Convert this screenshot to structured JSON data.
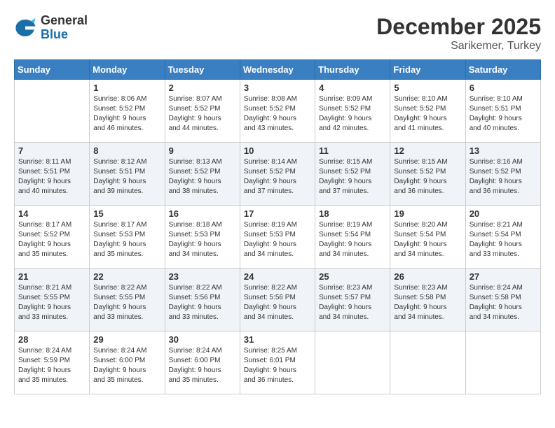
{
  "logo": {
    "general": "General",
    "blue": "Blue"
  },
  "title": {
    "month": "December 2025",
    "location": "Sarikemer, Turkey"
  },
  "weekdays": [
    "Sunday",
    "Monday",
    "Tuesday",
    "Wednesday",
    "Thursday",
    "Friday",
    "Saturday"
  ],
  "weeks": [
    [
      {
        "day": "",
        "info": ""
      },
      {
        "day": "1",
        "info": "Sunrise: 8:06 AM\nSunset: 5:52 PM\nDaylight: 9 hours\nand 46 minutes."
      },
      {
        "day": "2",
        "info": "Sunrise: 8:07 AM\nSunset: 5:52 PM\nDaylight: 9 hours\nand 44 minutes."
      },
      {
        "day": "3",
        "info": "Sunrise: 8:08 AM\nSunset: 5:52 PM\nDaylight: 9 hours\nand 43 minutes."
      },
      {
        "day": "4",
        "info": "Sunrise: 8:09 AM\nSunset: 5:52 PM\nDaylight: 9 hours\nand 42 minutes."
      },
      {
        "day": "5",
        "info": "Sunrise: 8:10 AM\nSunset: 5:52 PM\nDaylight: 9 hours\nand 41 minutes."
      },
      {
        "day": "6",
        "info": "Sunrise: 8:10 AM\nSunset: 5:51 PM\nDaylight: 9 hours\nand 40 minutes."
      }
    ],
    [
      {
        "day": "7",
        "info": "Sunrise: 8:11 AM\nSunset: 5:51 PM\nDaylight: 9 hours\nand 40 minutes."
      },
      {
        "day": "8",
        "info": "Sunrise: 8:12 AM\nSunset: 5:51 PM\nDaylight: 9 hours\nand 39 minutes."
      },
      {
        "day": "9",
        "info": "Sunrise: 8:13 AM\nSunset: 5:52 PM\nDaylight: 9 hours\nand 38 minutes."
      },
      {
        "day": "10",
        "info": "Sunrise: 8:14 AM\nSunset: 5:52 PM\nDaylight: 9 hours\nand 37 minutes."
      },
      {
        "day": "11",
        "info": "Sunrise: 8:15 AM\nSunset: 5:52 PM\nDaylight: 9 hours\nand 37 minutes."
      },
      {
        "day": "12",
        "info": "Sunrise: 8:15 AM\nSunset: 5:52 PM\nDaylight: 9 hours\nand 36 minutes."
      },
      {
        "day": "13",
        "info": "Sunrise: 8:16 AM\nSunset: 5:52 PM\nDaylight: 9 hours\nand 36 minutes."
      }
    ],
    [
      {
        "day": "14",
        "info": "Sunrise: 8:17 AM\nSunset: 5:52 PM\nDaylight: 9 hours\nand 35 minutes."
      },
      {
        "day": "15",
        "info": "Sunrise: 8:17 AM\nSunset: 5:53 PM\nDaylight: 9 hours\nand 35 minutes."
      },
      {
        "day": "16",
        "info": "Sunrise: 8:18 AM\nSunset: 5:53 PM\nDaylight: 9 hours\nand 34 minutes."
      },
      {
        "day": "17",
        "info": "Sunrise: 8:19 AM\nSunset: 5:53 PM\nDaylight: 9 hours\nand 34 minutes."
      },
      {
        "day": "18",
        "info": "Sunrise: 8:19 AM\nSunset: 5:54 PM\nDaylight: 9 hours\nand 34 minutes."
      },
      {
        "day": "19",
        "info": "Sunrise: 8:20 AM\nSunset: 5:54 PM\nDaylight: 9 hours\nand 34 minutes."
      },
      {
        "day": "20",
        "info": "Sunrise: 8:21 AM\nSunset: 5:54 PM\nDaylight: 9 hours\nand 33 minutes."
      }
    ],
    [
      {
        "day": "21",
        "info": "Sunrise: 8:21 AM\nSunset: 5:55 PM\nDaylight: 9 hours\nand 33 minutes."
      },
      {
        "day": "22",
        "info": "Sunrise: 8:22 AM\nSunset: 5:55 PM\nDaylight: 9 hours\nand 33 minutes."
      },
      {
        "day": "23",
        "info": "Sunrise: 8:22 AM\nSunset: 5:56 PM\nDaylight: 9 hours\nand 33 minutes."
      },
      {
        "day": "24",
        "info": "Sunrise: 8:22 AM\nSunset: 5:56 PM\nDaylight: 9 hours\nand 34 minutes."
      },
      {
        "day": "25",
        "info": "Sunrise: 8:23 AM\nSunset: 5:57 PM\nDaylight: 9 hours\nand 34 minutes."
      },
      {
        "day": "26",
        "info": "Sunrise: 8:23 AM\nSunset: 5:58 PM\nDaylight: 9 hours\nand 34 minutes."
      },
      {
        "day": "27",
        "info": "Sunrise: 8:24 AM\nSunset: 5:58 PM\nDaylight: 9 hours\nand 34 minutes."
      }
    ],
    [
      {
        "day": "28",
        "info": "Sunrise: 8:24 AM\nSunset: 5:59 PM\nDaylight: 9 hours\nand 35 minutes."
      },
      {
        "day": "29",
        "info": "Sunrise: 8:24 AM\nSunset: 6:00 PM\nDaylight: 9 hours\nand 35 minutes."
      },
      {
        "day": "30",
        "info": "Sunrise: 8:24 AM\nSunset: 6:00 PM\nDaylight: 9 hours\nand 35 minutes."
      },
      {
        "day": "31",
        "info": "Sunrise: 8:25 AM\nSunset: 6:01 PM\nDaylight: 9 hours\nand 36 minutes."
      },
      {
        "day": "",
        "info": ""
      },
      {
        "day": "",
        "info": ""
      },
      {
        "day": "",
        "info": ""
      }
    ]
  ]
}
